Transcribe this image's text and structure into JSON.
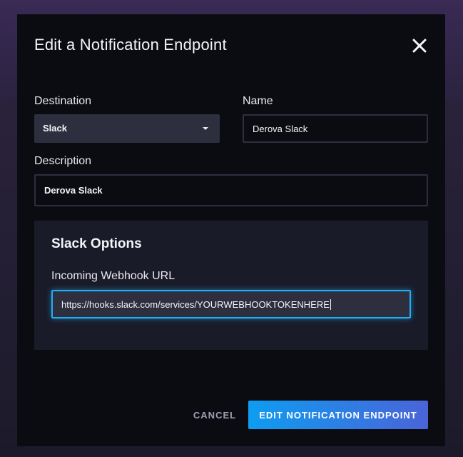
{
  "dialog": {
    "title": "Edit a Notification Endpoint",
    "close_icon": "close-icon"
  },
  "form": {
    "destination": {
      "label": "Destination",
      "value": "Slack"
    },
    "name": {
      "label": "Name",
      "value": "Derova Slack"
    },
    "description": {
      "label": "Description",
      "value": "Derova Slack"
    }
  },
  "slack_options": {
    "title": "Slack Options",
    "webhook": {
      "label": "Incoming Webhook URL",
      "value": "https://hooks.slack.com/services/YOURWEBHOOKTOKENHERE"
    }
  },
  "actions": {
    "cancel_label": "CANCEL",
    "submit_label": "EDIT NOTIFICATION ENDPOINT"
  },
  "colors": {
    "accent": "#22adf6",
    "button_gradient_start": "#0e9cf1",
    "button_gradient_end": "#4a64d8",
    "modal_bg": "#0b0c12",
    "panel_bg": "#1a1b28"
  }
}
